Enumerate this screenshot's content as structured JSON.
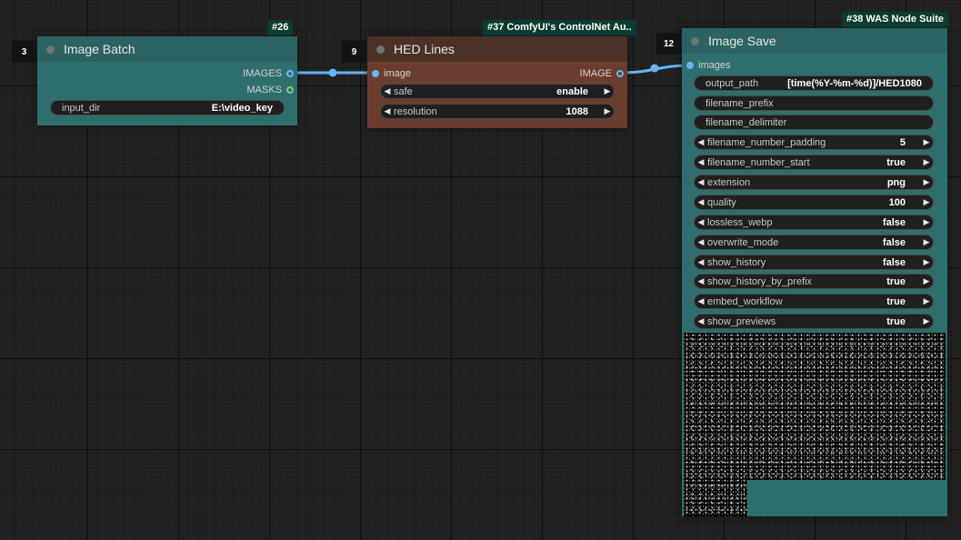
{
  "canvas": {
    "background": "#222222"
  },
  "nodes": {
    "image_batch": {
      "id_tag": "#26",
      "order": "3",
      "title": "Image Batch",
      "color": "#2e6f6d",
      "outputs": [
        {
          "label": "IMAGES",
          "socket_color": "#64b5f6"
        },
        {
          "label": "MASKS",
          "socket_color": "#81c784"
        }
      ],
      "widgets": [
        {
          "label": "input_dir",
          "value": "E:\\video_key"
        }
      ]
    },
    "hed_lines": {
      "id_tag": "#37 ComfyUI's ControlNet Au..",
      "order": "9",
      "title": "HED Lines",
      "header_color": "#4c3128",
      "body_color": "#6b3d2e",
      "input": {
        "label": "image",
        "socket_color": "#64b5f6"
      },
      "output": {
        "label": "IMAGE",
        "socket_color": "#64b5f6"
      },
      "widgets": [
        {
          "label": "safe",
          "value": "enable"
        },
        {
          "label": "resolution",
          "value": "1088"
        }
      ]
    },
    "image_save": {
      "id_tag": "#38 WAS Node Suite",
      "order": "12",
      "title": "Image Save",
      "color": "#2e6f6d",
      "input": {
        "label": "images",
        "socket_color": "#64b5f6"
      },
      "widgets": [
        {
          "label": "output_path",
          "value": "[time(%Y-%m-%d)]/HED1080",
          "type": "text"
        },
        {
          "label": "filename_prefix",
          "value": "",
          "type": "text"
        },
        {
          "label": "filename_delimiter",
          "value": "",
          "type": "text"
        },
        {
          "label": "filename_number_padding",
          "value": "5",
          "type": "combo"
        },
        {
          "label": "filename_number_start",
          "value": "true",
          "type": "combo"
        },
        {
          "label": "extension",
          "value": "png",
          "type": "combo"
        },
        {
          "label": "quality",
          "value": "100",
          "type": "combo"
        },
        {
          "label": "lossless_webp",
          "value": "false",
          "type": "combo"
        },
        {
          "label": "overwrite_mode",
          "value": "false",
          "type": "combo"
        },
        {
          "label": "show_history",
          "value": "false",
          "type": "combo"
        },
        {
          "label": "show_history_by_prefix",
          "value": "true",
          "type": "combo"
        },
        {
          "label": "embed_workflow",
          "value": "true",
          "type": "combo"
        },
        {
          "label": "show_previews",
          "value": "true",
          "type": "combo"
        }
      ]
    }
  },
  "link_color": "#64b5f6"
}
